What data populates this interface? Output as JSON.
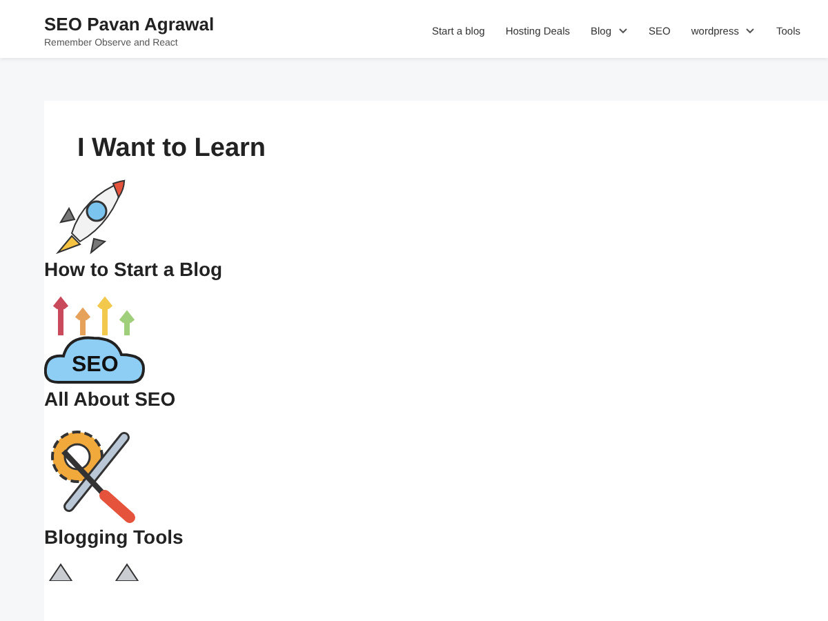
{
  "site": {
    "title": "SEO Pavan Agrawal",
    "tagline": "Remember Observe and React"
  },
  "nav": [
    {
      "label": "Start a blog",
      "dropdown": false
    },
    {
      "label": "Hosting Deals",
      "dropdown": false
    },
    {
      "label": "Blog",
      "dropdown": true
    },
    {
      "label": "SEO",
      "dropdown": false
    },
    {
      "label": "wordpress",
      "dropdown": true
    },
    {
      "label": "Tools",
      "dropdown": false
    }
  ],
  "heading": "I Want to Learn",
  "items": [
    {
      "kind": "rocket",
      "label": "How to Start a Blog"
    },
    {
      "kind": "seo",
      "icon_text": "SEO",
      "label": "All About SEO"
    },
    {
      "kind": "tools",
      "label": "Blogging Tools"
    },
    {
      "kind": "cones"
    }
  ]
}
